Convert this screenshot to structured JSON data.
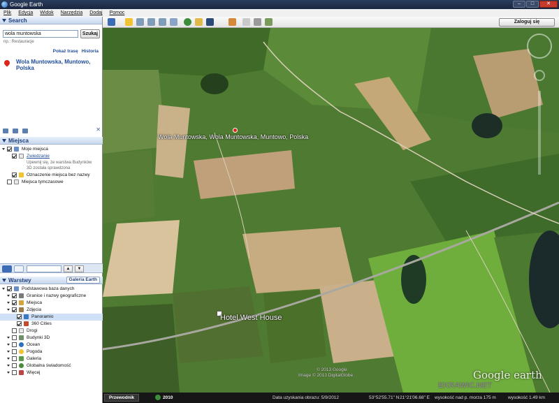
{
  "window": {
    "title": "Google Earth"
  },
  "menu": [
    "Plik",
    "Edycja",
    "Widok",
    "Narzędzia",
    "Dodaj",
    "Pomoc"
  ],
  "search": {
    "header": "Search",
    "value": "wola muntowska",
    "button": "Szukaj",
    "hint": "np.: Restauracje",
    "link_route": "Pokaż trasę",
    "link_history": "Historia",
    "result": "Wola Muntowska, Muntowo, Polska"
  },
  "places": {
    "header": "Miejsca",
    "items": [
      {
        "label": "Moje miejsca"
      },
      {
        "label": "Zwiedzanie"
      },
      {
        "label": "Upewnij się, że warstwa Budynków"
      },
      {
        "label": "3D została sprawdzona"
      },
      {
        "label": "Oznaczenie miejsca bez nazwy"
      },
      {
        "label": "Miejsca tymczasowe"
      }
    ]
  },
  "layers": {
    "header": "Warstwy",
    "gallery_button": "Galeria Earth",
    "items": [
      {
        "label": "Podstawowa baza danych"
      },
      {
        "label": "Granice i nazwy geograficzne"
      },
      {
        "label": "Miejsca"
      },
      {
        "label": "Zdjęcia"
      },
      {
        "label": "Panoramio"
      },
      {
        "label": "360 Cities"
      },
      {
        "label": "Drogi"
      },
      {
        "label": "Budynki 3D"
      },
      {
        "label": "Ocean"
      },
      {
        "label": "Pogoda"
      },
      {
        "label": "Galeria"
      },
      {
        "label": "Globalna świadomość"
      },
      {
        "label": "Więcej"
      }
    ]
  },
  "toolbar": {
    "login": "Zaloguj się"
  },
  "map": {
    "place_label": "Wola Muntowska, Wola Muntowska, Muntowo, Polska",
    "hotel_label": "Hotel West House",
    "copyright1": "© 2013 Google",
    "copyright2": "Image © 2013 DigitalGlobe",
    "brand": "Google earth",
    "watermark": "EKRAWIC.NET"
  },
  "status": {
    "guide": "Przewodnik",
    "year": "2010",
    "imagery_date": "Data uzyskania obrazu: 5/9/2012",
    "lat": "53°52'55.71\" N",
    "lon": "21°21'06.68\" E",
    "elev": "wysokość nad p. morza  175 m",
    "eye": "wysokość 1.49 km"
  }
}
